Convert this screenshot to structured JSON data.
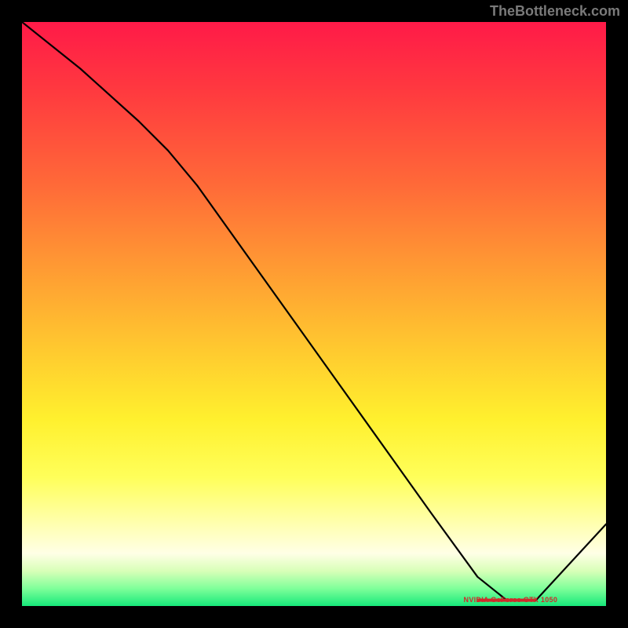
{
  "watermark": "TheBottleneck.com",
  "bar_label_text": "NVIDIA GeForce GTX 1050",
  "chart_data": {
    "type": "line",
    "title": "",
    "xlabel": "",
    "ylabel": "",
    "xlim": [
      0,
      100
    ],
    "ylim": [
      0,
      100
    ],
    "series": [
      {
        "name": "bottleneck-curve",
        "x": [
          0,
          10,
          20,
          25,
          30,
          40,
          50,
          60,
          70,
          78,
          83,
          88,
          100
        ],
        "values": [
          100,
          92,
          83,
          78,
          72,
          58,
          44,
          30,
          16,
          5,
          1,
          1,
          14
        ]
      }
    ],
    "marker": {
      "label": "NVIDIA GeForce GTX 1050",
      "x_start": 78,
      "x_end": 88,
      "y": 1
    }
  }
}
